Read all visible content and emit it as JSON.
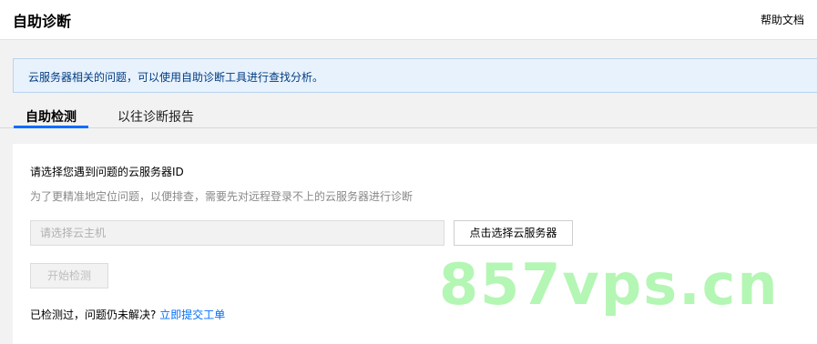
{
  "header": {
    "title": "自助诊断",
    "help_link": "帮助文档"
  },
  "notice": {
    "text": "云服务器相关的问题，可以使用自助诊断工具进行查找分析。"
  },
  "tabs": [
    {
      "label": "自助检测",
      "active": true
    },
    {
      "label": "以往诊断报告",
      "active": false
    }
  ],
  "panel": {
    "title": "请选择您遇到问题的云服务器ID",
    "description": "为了更精准地定位问题，以便排查，需要先对远程登录不上的云服务器进行诊断",
    "select_placeholder": "请选择云主机",
    "choose_button": "点击选择云服务器",
    "start_button": "开始检测",
    "footer_prefix": "已检测过，问题仍未解决?",
    "footer_link": "立即提交工单"
  },
  "watermark": "857vps.cn",
  "colors": {
    "accent": "#006eff",
    "notice_bg": "#e8f2fd",
    "watermark": "#a8f5a8"
  }
}
